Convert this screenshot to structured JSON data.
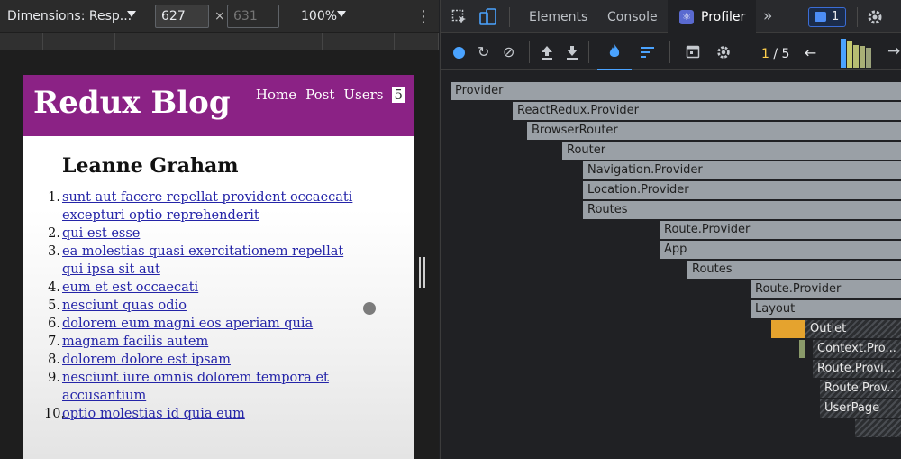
{
  "device_toolbar": {
    "dimensions_label": "Dimensions: Resp...",
    "width": "627",
    "times": "×",
    "height_placeholder": "631",
    "zoom": "100%",
    "more": "⋮"
  },
  "blog": {
    "title": "Redux Blog",
    "nav": {
      "home": "Home",
      "post": "Post",
      "users": "Users",
      "count": "5"
    },
    "user_name": "Leanne Graham",
    "posts": [
      {
        "n": "1.",
        "title": "sunt aut facere repellat provident occaecati excepturi optio reprehenderit"
      },
      {
        "n": "2.",
        "title": "qui est esse"
      },
      {
        "n": "3.",
        "title": "ea molestias quasi exercitationem repellat qui ipsa sit aut"
      },
      {
        "n": "4.",
        "title": "eum et est occaecati"
      },
      {
        "n": "5.",
        "title": "nesciunt quas odio"
      },
      {
        "n": "6.",
        "title": "dolorem eum magni eos aperiam quia"
      },
      {
        "n": "7.",
        "title": "magnam facilis autem"
      },
      {
        "n": "8.",
        "title": "dolorem dolore est ipsam"
      },
      {
        "n": "9.",
        "title": "nesciunt iure omnis dolorem tempora et accusantium"
      },
      {
        "n": "10.",
        "title": "optio molestias id quia eum"
      }
    ]
  },
  "devtools": {
    "tabs": {
      "elements": "Elements",
      "console": "Console",
      "profiler": "Profiler",
      "more": "»"
    },
    "issues_count": "1",
    "profiler": {
      "commit_current": "1",
      "commit_separator": "/",
      "commit_total": "5",
      "prev": "←",
      "next": "→"
    },
    "flame": [
      {
        "label": "Provider"
      },
      {
        "label": "ReactRedux.Provider"
      },
      {
        "label": "BrowserRouter"
      },
      {
        "label": "Router"
      },
      {
        "label": "Navigation.Provider"
      },
      {
        "label": "Location.Provider"
      },
      {
        "label": "Routes"
      },
      {
        "label": "Route.Provider"
      },
      {
        "label": "App"
      },
      {
        "label": "Routes"
      },
      {
        "label": "Route.Provider"
      },
      {
        "label": "Layout"
      },
      {
        "label": "Outlet"
      },
      {
        "label": "Context.Pro..."
      },
      {
        "label": "Route.Provi..."
      },
      {
        "label": "Route.Prov..."
      },
      {
        "label": "UserPage"
      }
    ]
  },
  "colors": {
    "blog_header": "#8b2285",
    "link": "#2424a8",
    "flame_gray": "#9aa0a6",
    "flame_gold": "#e5a32e",
    "accent_blue": "#4aa3ff"
  }
}
